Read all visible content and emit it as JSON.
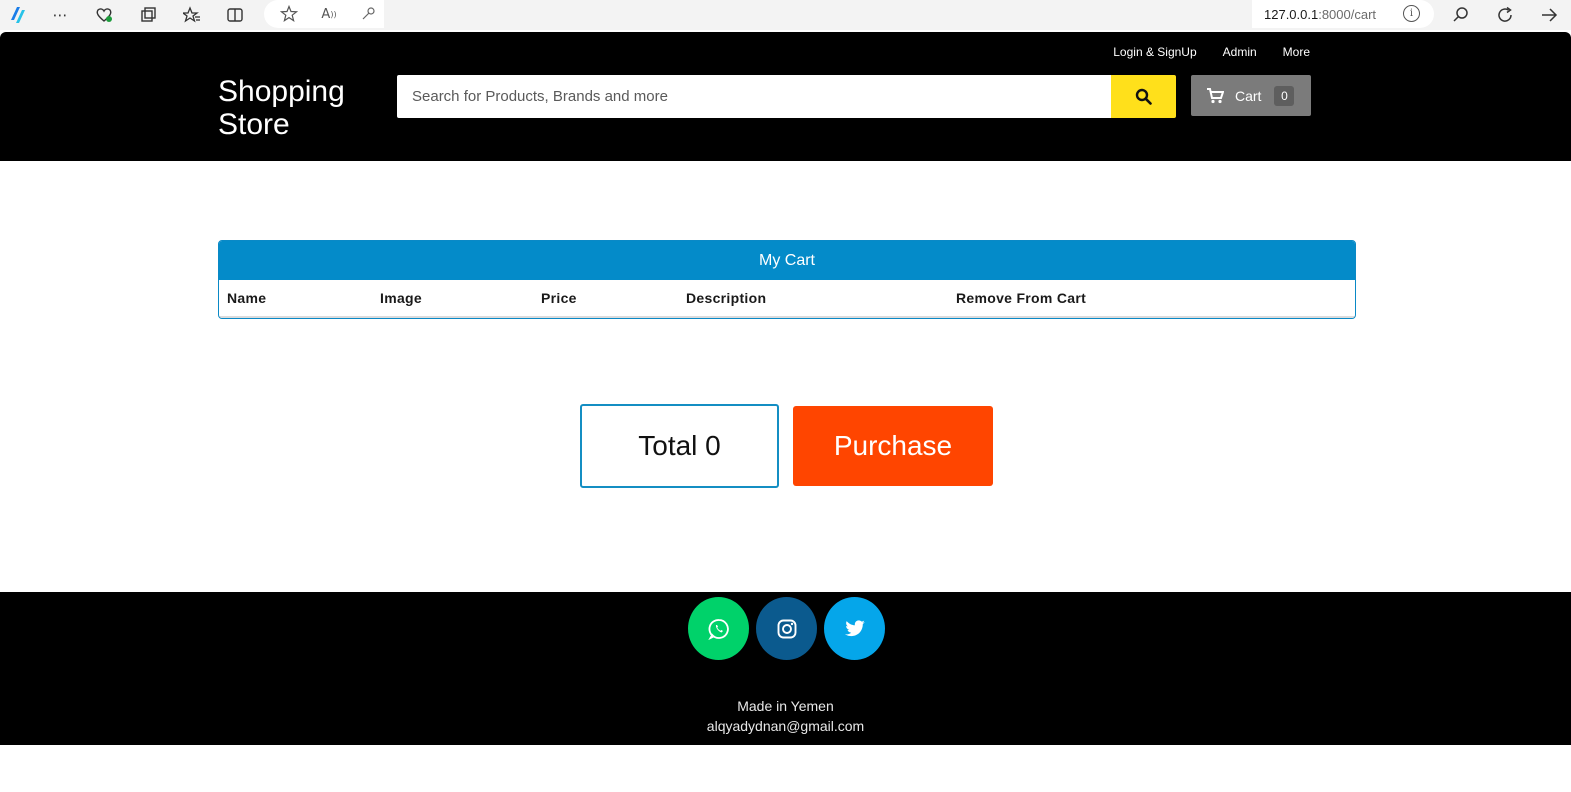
{
  "browser": {
    "url_host": "127.0.0.1",
    "url_path": ":8000/cart",
    "info_glyph": "i"
  },
  "header": {
    "top_links": [
      "Login & SignUp",
      "Admin",
      "More"
    ],
    "brand_line1": "Shopping",
    "brand_line2": "Store",
    "search_placeholder": "Search for Products, Brands and more",
    "cart_label": "Cart",
    "cart_count": "0"
  },
  "cart": {
    "title": "My Cart",
    "columns": [
      "Name",
      "Image",
      "Price",
      "Description",
      "Remove From Cart"
    ]
  },
  "summary": {
    "total_text": "Total 0",
    "purchase_label": "Purchase"
  },
  "footer": {
    "line1": "Made in Yemen",
    "line2": "alqyadydnan@gmail.com"
  },
  "colors": {
    "header_bg": "#000000",
    "search_button": "#ffe01b",
    "cart_button": "#7b7b7b",
    "panel_header": "#048bc9",
    "purchase": "#ff4500",
    "whatsapp": "#00d26a",
    "instagram": "#0b5a8e",
    "twitter": "#05a6ea"
  },
  "icons": {
    "search": "search-icon",
    "cart": "shopping-cart-icon",
    "whatsapp": "whatsapp-icon",
    "instagram": "instagram-icon",
    "twitter": "twitter-icon"
  }
}
